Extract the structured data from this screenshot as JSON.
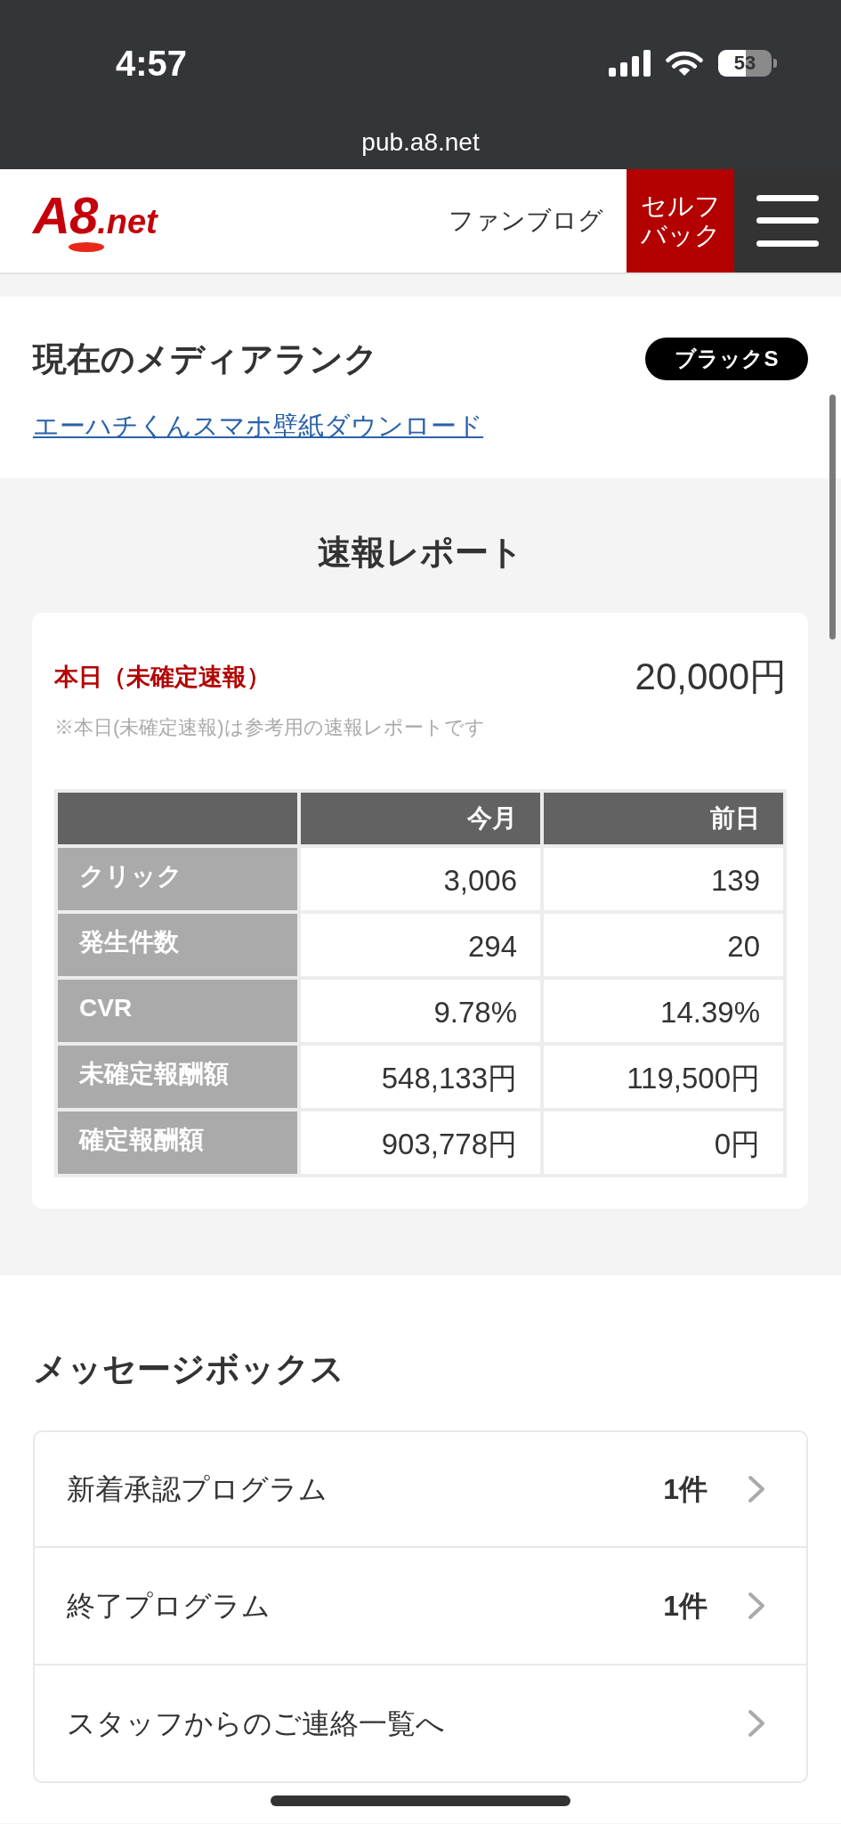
{
  "status_bar": {
    "time": "4:57",
    "battery": "53"
  },
  "browser": {
    "url": "pub.a8.net"
  },
  "header": {
    "logo": {
      "mark": "A8",
      "suffix": ".net"
    },
    "nav_link": "ファンブログ",
    "selfback_button": "セルフバック"
  },
  "media_rank": {
    "title": "現在のメディアランク",
    "badge": "ブラックS",
    "link": "エーハチくんスマホ壁紙ダウンロード"
  },
  "report": {
    "title": "速報レポート",
    "today_label": "本日（未確定速報）",
    "today_amount": "20,000円",
    "note": "※本日(未確定速報)は参考用の速報レポートです",
    "table": {
      "columns": [
        "今月",
        "前日"
      ],
      "rows": [
        {
          "label": "クリック",
          "values": [
            "3,006",
            "139"
          ]
        },
        {
          "label": "発生件数",
          "values": [
            "294",
            "20"
          ]
        },
        {
          "label": "CVR",
          "values": [
            "9.78%",
            "14.39%"
          ]
        },
        {
          "label": "未確定報酬額",
          "values": [
            "548,133円",
            "119,500円"
          ]
        },
        {
          "label": "確定報酬額",
          "values": [
            "903,778円",
            "0円"
          ]
        }
      ]
    }
  },
  "message_box": {
    "title": "メッセージボックス",
    "items": [
      {
        "label": "新着承認プログラム",
        "count": "1件"
      },
      {
        "label": "終了プログラム",
        "count": "1件"
      },
      {
        "label": "スタッフからのご連絡一覧へ"
      }
    ]
  }
}
